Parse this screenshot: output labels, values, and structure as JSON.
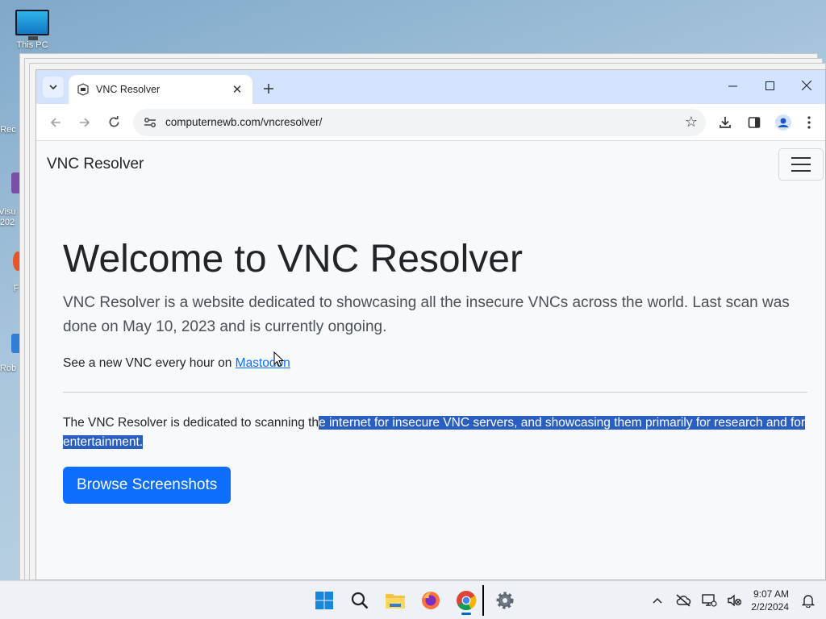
{
  "desktop": {
    "icons": [
      {
        "label": "This PC"
      },
      {
        "label": "Rec"
      },
      {
        "label": "Visu"
      },
      {
        "label": "202"
      },
      {
        "label": "F"
      },
      {
        "label": "Rob"
      }
    ]
  },
  "browser": {
    "tab": {
      "title": "VNC Resolver",
      "close_icon": "close-icon"
    },
    "new_tab_icon": "plus-icon",
    "address": {
      "url": "computernewb.com/vncresolver/"
    },
    "window_controls": [
      "minimize",
      "maximize",
      "close"
    ]
  },
  "page": {
    "brand": "VNC Resolver",
    "hero_title": "Welcome to VNC Resolver",
    "lead": "VNC Resolver is a website dedicated to showcasing all the insecure VNCs across the world. Last scan was done on May 10, 2023 and is currently ongoing.",
    "mastodon_prefix": "See a new VNC every hour on ",
    "mastodon_link": "Mastodon",
    "desc_before": "The VNC Resolver is dedicated to scanning th",
    "desc_selected": "e internet for insecure VNC servers, and showcasing them primarily for research and for entertainment.",
    "browse_button": "Browse Screenshots"
  },
  "taskbar": {
    "time": "9:07 AM",
    "date": "2/2/2024",
    "apps": [
      "start",
      "search",
      "file-explorer",
      "firefox",
      "chrome",
      "settings"
    ]
  },
  "colors": {
    "accent": "#0d6efd",
    "selection": "#2a5fc2",
    "tab_strip": "#d3e3fd"
  }
}
